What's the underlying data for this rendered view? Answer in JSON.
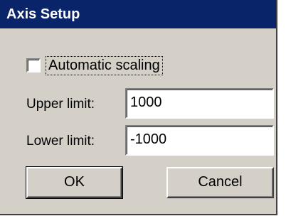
{
  "window": {
    "title": "Axis Setup"
  },
  "auto_scaling": {
    "label": "Automatic scaling",
    "checked": false
  },
  "fields": {
    "upper": {
      "label": "Upper limit:",
      "value": "1000"
    },
    "lower": {
      "label": "Lower limit:",
      "value": "-1000"
    }
  },
  "buttons": {
    "ok": "OK",
    "cancel": "Cancel"
  },
  "colors": {
    "titlebar": "#0a246a",
    "face": "#d4d0c8"
  }
}
